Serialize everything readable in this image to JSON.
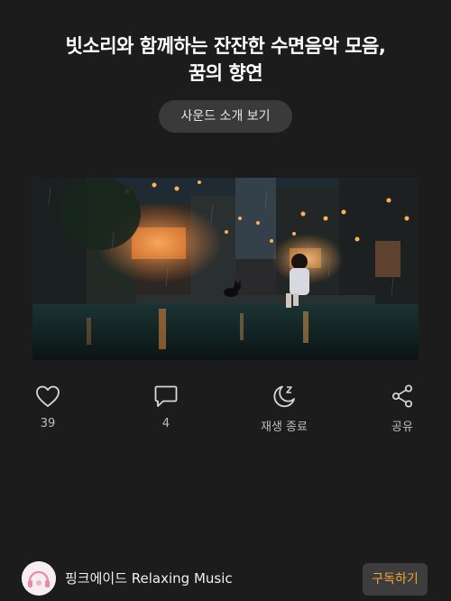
{
  "video": {
    "title_line1": "빗소리와 함께하는 잔잔한 수면음악 모음,",
    "title_line2": "꿈의 향연",
    "sound_button": "사운드 소개 보기"
  },
  "actions": {
    "like": {
      "icon": "heart-icon",
      "label": "39"
    },
    "comment": {
      "icon": "comment-icon",
      "label": "4"
    },
    "sleep_timer": {
      "icon": "moon-sleep-icon",
      "label": "재생 종료"
    },
    "share": {
      "icon": "share-icon",
      "label": "공유"
    }
  },
  "channel": {
    "name": "핑크에이드 Relaxing Music",
    "subscribe_label": "구독하기",
    "accent_color": "#f2a43a",
    "avatar_icon": "pink-headphones-logo"
  },
  "colors": {
    "background": "#1c1c1c",
    "button_bg": "#3a3a3a"
  }
}
